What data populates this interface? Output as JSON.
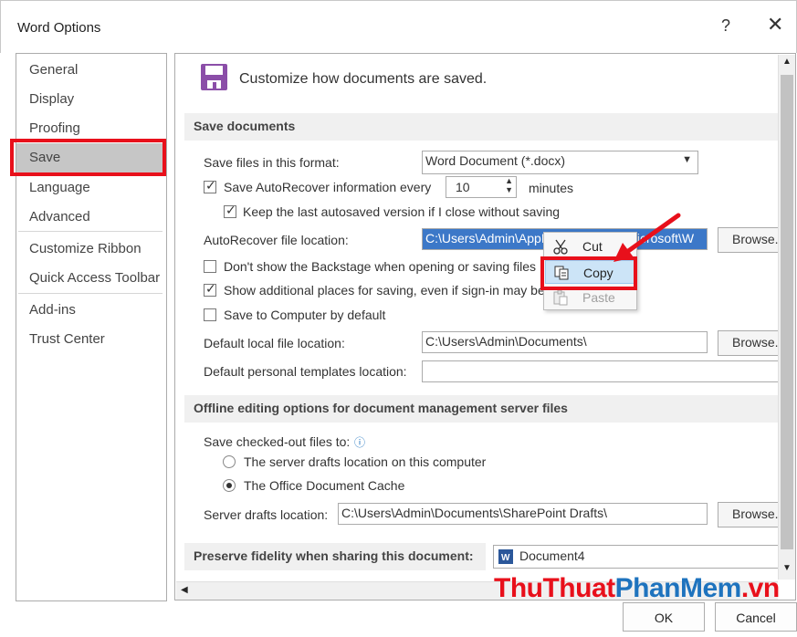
{
  "window": {
    "title": "Word Options",
    "help": "?",
    "close": "✕"
  },
  "nav": {
    "items": [
      "General",
      "Display",
      "Proofing",
      "Save",
      "Language",
      "Advanced",
      "Customize Ribbon",
      "Quick Access Toolbar",
      "Add-ins",
      "Trust Center"
    ],
    "selected": "Save"
  },
  "header": {
    "text": "Customize how documents are saved."
  },
  "save_documents": {
    "title": "Save documents",
    "format_label": "Save files in this format:",
    "format_value": "Word Document (*.docx)",
    "autorecover_label": "Save AutoRecover information every",
    "autorecover_checked": true,
    "autorecover_minutes": "10",
    "minutes_label": "minutes",
    "keep_last_label": "Keep the last autosaved version if I close without saving",
    "keep_last_checked": true,
    "autorecover_location_label": "AutoRecover file location:",
    "autorecover_location_value": "C:\\Users\\Admin\\AppData\\Roaming\\Microsoft\\W",
    "browse": "Browse...",
    "backstage_label": "Don't show the Backstage when opening or saving files",
    "backstage_checked": false,
    "additional_places_label": "Show additional places for saving, even if sign-in may be required.",
    "additional_places_checked": true,
    "save_to_computer_label": "Save to Computer by default",
    "save_to_computer_checked": false,
    "default_local_label": "Default local file location:",
    "default_local_value": "C:\\Users\\Admin\\Documents\\",
    "default_templates_label": "Default personal templates location:",
    "default_templates_value": ""
  },
  "offline": {
    "title": "Offline editing options for document management server files",
    "checked_out_label": "Save checked-out files to:",
    "server_drafts_option": "The server drafts location on this computer",
    "office_cache_option": "The Office Document Cache",
    "selected_option": "office_cache",
    "server_drafts_label": "Server drafts location:",
    "server_drafts_value": "C:\\Users\\Admin\\Documents\\SharePoint Drafts\\",
    "browse": "Browse..."
  },
  "fidelity": {
    "title": "Preserve fidelity when sharing this document:",
    "document": "Document4"
  },
  "context_menu": {
    "cut": "Cut",
    "copy": "Copy",
    "paste": "Paste"
  },
  "footer": {
    "ok": "OK",
    "cancel": "Cancel"
  },
  "watermark": {
    "part1": "ThuThuat",
    "part2": "PhanMem",
    "part3": ".vn"
  },
  "colors": {
    "highlight_red": "#e8101b",
    "selection_blue": "#cce4f7",
    "nav_selected": "#c6c6c6",
    "save_icon": "#8b4ea8",
    "watermark_red": "#e8101b",
    "watermark_blue": "#1e73be"
  }
}
